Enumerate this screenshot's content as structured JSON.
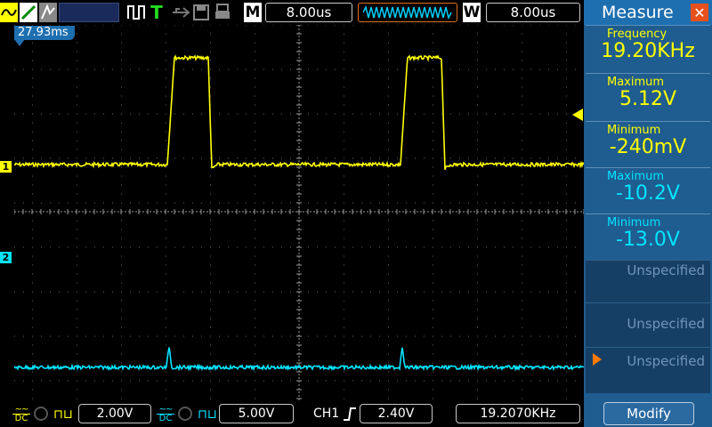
{
  "toolbar": {
    "m_label": "M",
    "m_value": "8.00us",
    "w_label": "W",
    "w_value": "8.00us",
    "trigger_mode_letter": "T"
  },
  "screen": {
    "cursor_time": "27.93ms",
    "ch1_marker": "1",
    "ch2_marker": "2"
  },
  "bottom": {
    "ch1_scale": "2.00V",
    "ch2_scale": "5.00V",
    "trigger_source": "CH1",
    "trigger_level": "2.40V",
    "frequency": "19.2070KHz",
    "dc1": "DC",
    "dc2": "DC"
  },
  "measure": {
    "title": "Measure",
    "items": [
      {
        "label": "Frequency",
        "value": "19.20KHz",
        "color": "#ffff00"
      },
      {
        "label": "Maximum",
        "value": "5.12V",
        "color": "#ffff00"
      },
      {
        "label": "Minimum",
        "value": "-240mV",
        "color": "#ffff00"
      },
      {
        "label": "Maximum",
        "value": "-10.2V",
        "color": "#00e5ff"
      },
      {
        "label": "Minimum",
        "value": "-13.0V",
        "color": "#00e5ff"
      }
    ],
    "empty": [
      "Unspecified",
      "Unspecified",
      "Unspecified"
    ],
    "modify": "Modify"
  },
  "colors": {
    "ch1": "#ffff00",
    "ch2": "#00e5ff",
    "trigger": "#ff8800"
  }
}
